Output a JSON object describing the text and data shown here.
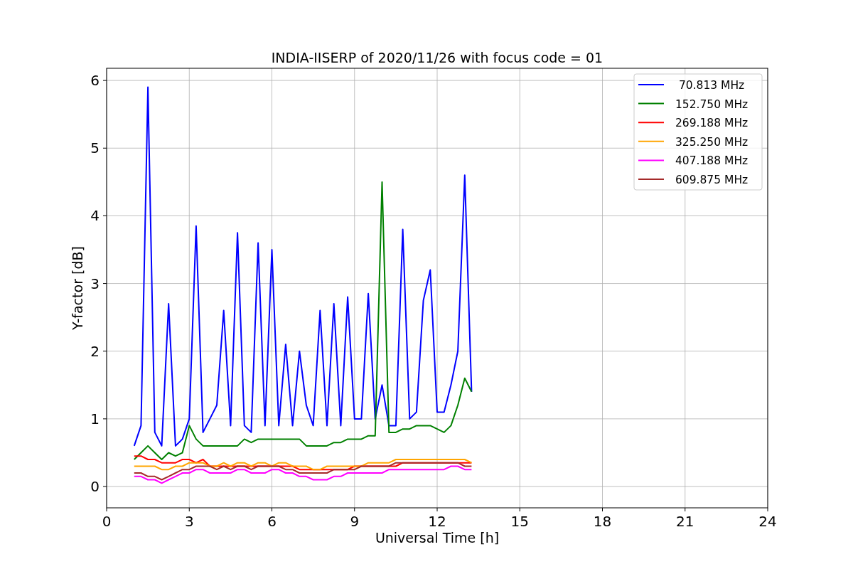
{
  "chart_data": {
    "type": "line",
    "title": "INDIA-IISERP of 2020/11/26 with focus code = 01",
    "xlabel": "Universal Time [h]",
    "ylabel": "Y-factor [dB]",
    "x": [
      1,
      1.25,
      1.5,
      1.75,
      2,
      2.25,
      2.5,
      2.75,
      3,
      3.25,
      3.5,
      3.75,
      4,
      4.25,
      4.5,
      4.75,
      5,
      5.25,
      5.5,
      5.75,
      6,
      6.25,
      6.5,
      6.75,
      7,
      7.25,
      7.5,
      7.75,
      8,
      8.25,
      8.5,
      8.75,
      9,
      9.25,
      9.5,
      9.75,
      10,
      10.25,
      10.5,
      10.75,
      11,
      11.25,
      11.5,
      11.75,
      12,
      12.25,
      12.5,
      12.75,
      13,
      13.25
    ],
    "series": [
      {
        "name": " 70.813 MHz",
        "color": "#0000ff",
        "values": [
          0.6,
          0.9,
          5.9,
          0.8,
          0.6,
          2.7,
          0.6,
          0.7,
          1.0,
          3.85,
          0.8,
          1.0,
          1.2,
          2.6,
          0.9,
          3.75,
          0.9,
          0.8,
          3.6,
          0.9,
          3.5,
          0.9,
          2.1,
          0.9,
          2.0,
          1.2,
          0.9,
          2.6,
          0.9,
          2.7,
          0.9,
          2.8,
          1.0,
          1.0,
          2.85,
          1.0,
          1.5,
          0.9,
          0.9,
          3.8,
          1.0,
          1.1,
          2.75,
          3.2,
          1.1,
          1.1,
          1.5,
          2.0,
          4.6,
          1.4
        ]
      },
      {
        "name": "152.750 MHz",
        "color": "#008000",
        "values": [
          0.4,
          0.5,
          0.6,
          0.5,
          0.4,
          0.5,
          0.45,
          0.5,
          0.9,
          0.7,
          0.6,
          0.6,
          0.6,
          0.6,
          0.6,
          0.6,
          0.7,
          0.65,
          0.7,
          0.7,
          0.7,
          0.7,
          0.7,
          0.7,
          0.7,
          0.6,
          0.6,
          0.6,
          0.6,
          0.65,
          0.65,
          0.7,
          0.7,
          0.7,
          0.75,
          0.75,
          4.5,
          0.8,
          0.8,
          0.85,
          0.85,
          0.9,
          0.9,
          0.9,
          0.85,
          0.8,
          0.9,
          1.2,
          1.6,
          1.4
        ]
      },
      {
        "name": "269.188 MHz",
        "color": "#ff0000",
        "values": [
          0.45,
          0.45,
          0.4,
          0.4,
          0.35,
          0.35,
          0.35,
          0.4,
          0.4,
          0.35,
          0.4,
          0.3,
          0.3,
          0.3,
          0.3,
          0.3,
          0.3,
          0.3,
          0.3,
          0.3,
          0.3,
          0.3,
          0.3,
          0.3,
          0.25,
          0.25,
          0.25,
          0.25,
          0.25,
          0.25,
          0.25,
          0.25,
          0.3,
          0.3,
          0.3,
          0.3,
          0.3,
          0.3,
          0.3,
          0.35,
          0.35,
          0.35,
          0.35,
          0.35,
          0.35,
          0.35,
          0.35,
          0.35,
          0.35,
          0.35
        ]
      },
      {
        "name": "325.250 MHz",
        "color": "#ffa500",
        "values": [
          0.3,
          0.3,
          0.3,
          0.3,
          0.25,
          0.25,
          0.3,
          0.3,
          0.35,
          0.35,
          0.35,
          0.3,
          0.3,
          0.35,
          0.3,
          0.35,
          0.35,
          0.3,
          0.35,
          0.35,
          0.3,
          0.35,
          0.35,
          0.3,
          0.3,
          0.3,
          0.25,
          0.25,
          0.3,
          0.3,
          0.3,
          0.3,
          0.3,
          0.3,
          0.35,
          0.35,
          0.35,
          0.35,
          0.4,
          0.4,
          0.4,
          0.4,
          0.4,
          0.4,
          0.4,
          0.4,
          0.4,
          0.4,
          0.4,
          0.35
        ]
      },
      {
        "name": "407.188 MHz",
        "color": "#ff00ff",
        "values": [
          0.15,
          0.15,
          0.1,
          0.1,
          0.05,
          0.1,
          0.15,
          0.2,
          0.2,
          0.25,
          0.25,
          0.2,
          0.2,
          0.2,
          0.2,
          0.25,
          0.25,
          0.2,
          0.2,
          0.2,
          0.25,
          0.25,
          0.2,
          0.2,
          0.15,
          0.15,
          0.1,
          0.1,
          0.1,
          0.15,
          0.15,
          0.2,
          0.2,
          0.2,
          0.2,
          0.2,
          0.2,
          0.25,
          0.25,
          0.25,
          0.25,
          0.25,
          0.25,
          0.25,
          0.25,
          0.25,
          0.3,
          0.3,
          0.25,
          0.25
        ]
      },
      {
        "name": "609.875 MHz",
        "color": "#a52a2a",
        "values": [
          0.2,
          0.2,
          0.15,
          0.15,
          0.1,
          0.15,
          0.2,
          0.25,
          0.25,
          0.3,
          0.3,
          0.3,
          0.25,
          0.3,
          0.25,
          0.3,
          0.3,
          0.25,
          0.3,
          0.3,
          0.3,
          0.3,
          0.25,
          0.25,
          0.2,
          0.2,
          0.2,
          0.2,
          0.2,
          0.25,
          0.25,
          0.25,
          0.25,
          0.3,
          0.3,
          0.3,
          0.3,
          0.3,
          0.35,
          0.35,
          0.35,
          0.35,
          0.35,
          0.35,
          0.35,
          0.35,
          0.35,
          0.35,
          0.3,
          0.3
        ]
      }
    ],
    "xlim": [
      0,
      24
    ],
    "ylim": [
      -0.315,
      6.18
    ],
    "xticks": [
      0,
      3,
      6,
      9,
      12,
      15,
      18,
      21,
      24
    ],
    "yticks": [
      0,
      1,
      2,
      3,
      4,
      5,
      6
    ],
    "grid": true,
    "legend": true
  }
}
